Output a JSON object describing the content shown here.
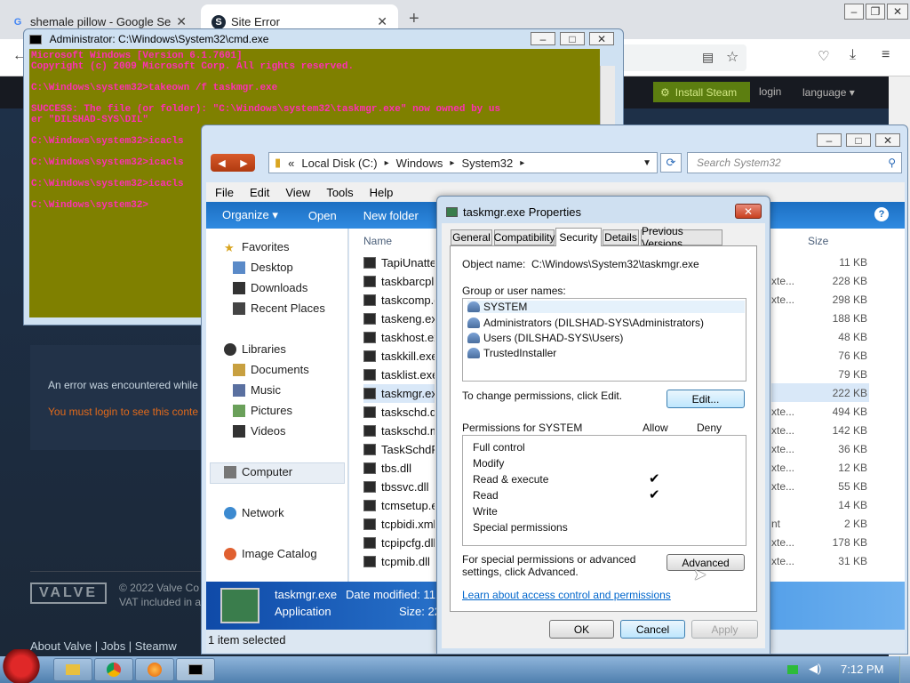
{
  "browser": {
    "tabs": [
      {
        "title": "shemale pillow - Google Se"
      },
      {
        "title": "Site Error"
      }
    ],
    "new_tab": "+",
    "window_buttons": [
      "–",
      "❐",
      "✕"
    ],
    "steam": {
      "install_label": "Install Steam",
      "login_label": "login",
      "language_label": "language ▾",
      "error_message": "An error was encountered while",
      "login_prompt": "You must login to see this conte",
      "logo": "VALVE",
      "copyright": "© 2022 Valve Co VAT included in a",
      "footer_links": "About Valve  |  Jobs  |  Steamw"
    }
  },
  "cmd": {
    "title": "Administrator: C:\\Windows\\System32\\cmd.exe",
    "lines": [
      "Microsoft Windows [Version 6.1.7601]",
      "Copyright (c) 2009 Microsoft Corp. All rights reserved.",
      "",
      "C:\\Windows\\system32>takeown /f taskmgr.exe",
      "",
      "SUCCESS: The file (or folder): \"C:\\Windows\\system32\\taskmgr.exe\" now owned by us",
      "er \"DILSHAD-SYS\\DIL\"",
      "",
      "C:\\Windows\\system32>icacls",
      "",
      "C:\\Windows\\system32>icacls",
      "",
      "C:\\Windows\\system32>icacls",
      "",
      "C:\\Windows\\system32>"
    ]
  },
  "explorer": {
    "breadcrumb": [
      "«",
      "Local Disk (C:)",
      "▸",
      "Windows",
      "▸",
      "System32",
      "▸"
    ],
    "search_placeholder": "Search System32",
    "menu": [
      "File",
      "Edit",
      "View",
      "Tools",
      "Help"
    ],
    "commands": [
      "Organize ▾",
      "Open",
      "New folder"
    ],
    "nav": {
      "favorites": "Favorites",
      "desktop": "Desktop",
      "downloads": "Downloads",
      "recent": "Recent Places",
      "libraries": "Libraries",
      "documents": "Documents",
      "music": "Music",
      "pictures": "Pictures",
      "videos": "Videos",
      "computer": "Computer",
      "network": "Network",
      "image_catalog": "Image Catalog"
    },
    "columns": {
      "name": "Name",
      "size": "Size"
    },
    "files": [
      {
        "name": "TapiUnattend",
        "type": "",
        "size": "11 KB"
      },
      {
        "name": "taskbarcpl",
        "type": "xte...",
        "size": "228 KB"
      },
      {
        "name": "taskcomp.dll",
        "type": "xte...",
        "size": "298 KB"
      },
      {
        "name": "taskeng.exe",
        "type": "",
        "size": "188 KB"
      },
      {
        "name": "taskhost.exe",
        "type": "",
        "size": "48 KB"
      },
      {
        "name": "taskkill.exe",
        "type": "",
        "size": "76 KB"
      },
      {
        "name": "tasklist.exe",
        "type": "",
        "size": "79 KB"
      },
      {
        "name": "taskmgr.exe",
        "type": "",
        "size": "222 KB"
      },
      {
        "name": "taskschd.dll",
        "type": "xte...",
        "size": "494 KB"
      },
      {
        "name": "taskschd.msc",
        "type": "xte...",
        "size": "142 KB"
      },
      {
        "name": "TaskSchdPS",
        "type": "xte...",
        "size": "36 KB"
      },
      {
        "name": "tbs.dll",
        "type": "xte...",
        "size": "12 KB"
      },
      {
        "name": "tbssvc.dll",
        "type": "xte...",
        "size": "55 KB"
      },
      {
        "name": "tcmsetup.exe",
        "type": "",
        "size": "14 KB"
      },
      {
        "name": "tcpbidi.xml",
        "type": "nt",
        "size": "2 KB"
      },
      {
        "name": "tcpipcfg.dll",
        "type": "xte...",
        "size": "178 KB"
      },
      {
        "name": "tcpmib.dll",
        "type": "xte...",
        "size": "31 KB"
      }
    ],
    "details": {
      "name": "taskmgr.exe",
      "type": "Application",
      "modified": "Date modified: 11",
      "size": "Size: 22"
    },
    "status": "1 item selected"
  },
  "props": {
    "title": "taskmgr.exe Properties",
    "close": "✕",
    "tabs": [
      "General",
      "Compatibility",
      "Security",
      "Details",
      "Previous Versions"
    ],
    "object_label": "Object name:",
    "object_value": "C:\\Windows\\System32\\taskmgr.exe",
    "group_label": "Group or user names:",
    "users": [
      "SYSTEM",
      "Administrators (DILSHAD-SYS\\Administrators)",
      "Users (DILSHAD-SYS\\Users)",
      "TrustedInstaller"
    ],
    "change_text": "To change permissions, click Edit.",
    "edit_button": "Edit...",
    "perm_label": "Permissions for SYSTEM",
    "allow": "Allow",
    "deny": "Deny",
    "permissions": [
      {
        "name": "Full control",
        "allow": ""
      },
      {
        "name": "Modify",
        "allow": ""
      },
      {
        "name": "Read & execute",
        "allow": "✔"
      },
      {
        "name": "Read",
        "allow": "✔"
      },
      {
        "name": "Write",
        "allow": ""
      },
      {
        "name": "Special permissions",
        "allow": ""
      }
    ],
    "special_text": "For special permissions or advanced settings, click Advanced.",
    "advanced_button": "Advanced",
    "learn_link": "Learn about access control and permissions",
    "ok": "OK",
    "cancel": "Cancel",
    "apply": "Apply"
  },
  "taskbar": {
    "clock": "7:12 PM"
  }
}
